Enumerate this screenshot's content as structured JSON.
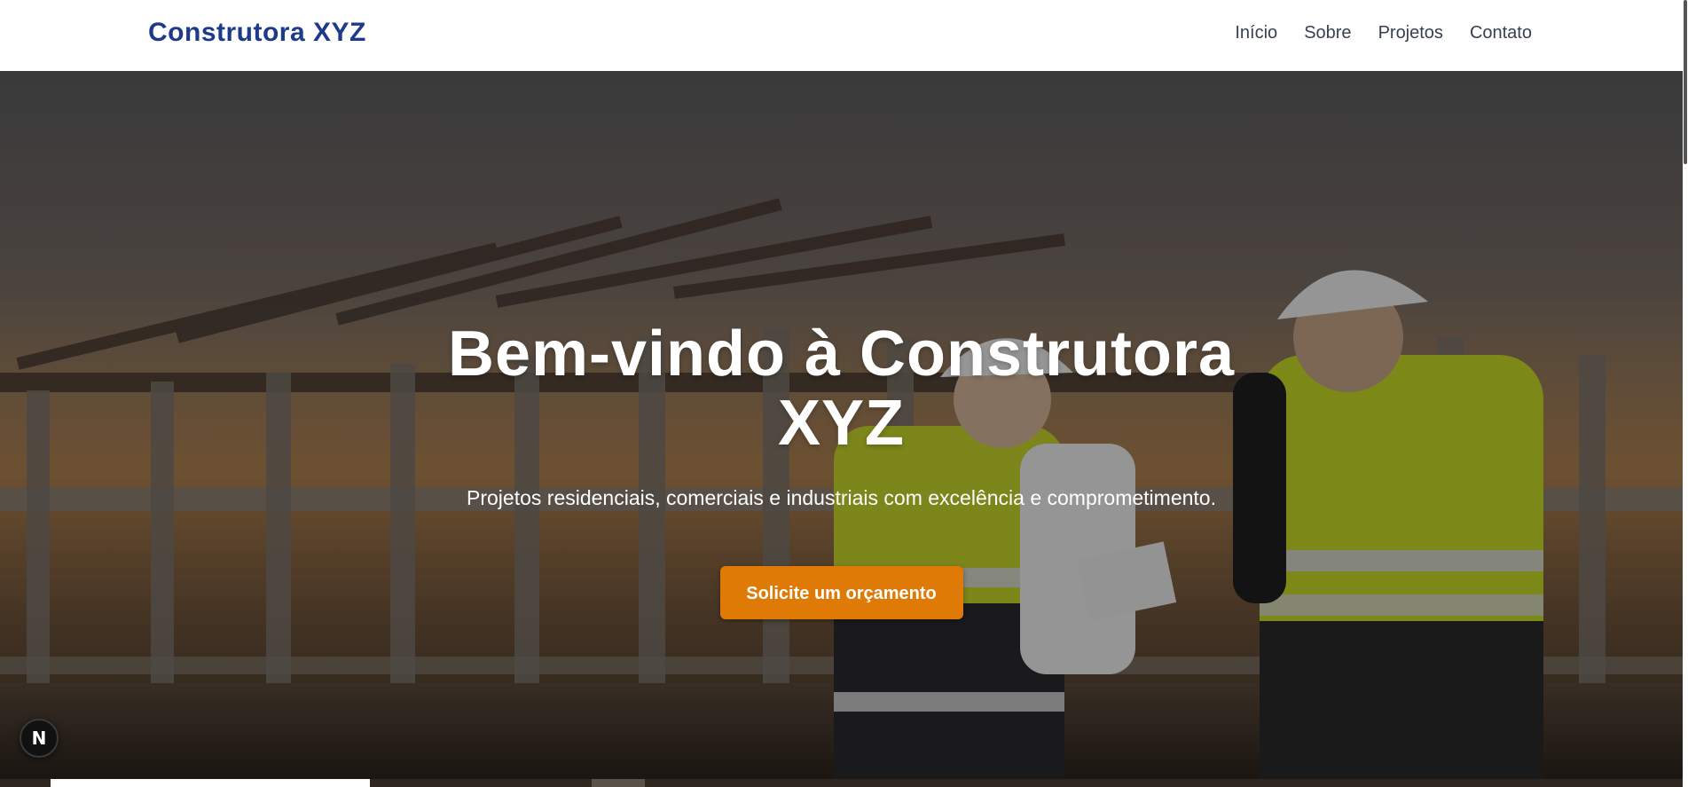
{
  "header": {
    "brand": "Construtora XYZ",
    "nav": [
      {
        "label": "Início"
      },
      {
        "label": "Sobre"
      },
      {
        "label": "Projetos"
      },
      {
        "label": "Contato"
      }
    ]
  },
  "hero": {
    "title": "Bem-vindo à Construtora XYZ",
    "subtitle": "Projetos residenciais, comerciais e industriais com excelência e comprometimento.",
    "cta_label": "Solicite um orçamento",
    "background_image": "construction-site-engineers-photo"
  },
  "dev_badge": {
    "letter": "N",
    "icon": "nextjs-icon"
  },
  "colors": {
    "brand": "#1e3a8a",
    "nav_text": "#374151",
    "cta": "#e07a06",
    "hero_overlay": "rgba(0,0,0,0.38)"
  }
}
